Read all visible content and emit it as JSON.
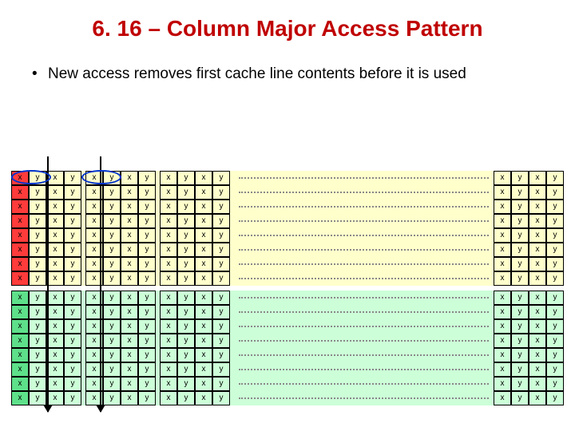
{
  "title": "6. 16 – Column Major Access Pattern",
  "bullet": "New access removes first cache line contents before it is used",
  "cell_x": "x",
  "cell_y": "y",
  "rows_per_block": 8,
  "groups_per_row": 3,
  "pairs_per_group": 2,
  "right_group_pairs": 2,
  "blocks": [
    {
      "bg": "top",
      "col0": "red"
    },
    {
      "bg": "bot",
      "col0": "green"
    }
  ],
  "chart_data": {
    "type": "table",
    "title": "Column Major Access Pattern cache layout",
    "description": "Two 8-row memory blocks (yellow then green). Each row is a sequence of interleaved x,y element pairs grouped into cache-line-sized chunks (4 elements = x y x y per group). Three full groups are shown on the left, an ellipsis, then one group on the right. First column of the top block is highlighted red (current cache line being evicted); first column of the bottom block is highlighted green (incoming cache line). Vertical arrows through column 0 and the start of the second cache-line group indicate column-major traversal order. Blue ellipses mark the first-row accesses in the first two cache lines.",
    "blocks": 2,
    "rows_per_block": 8,
    "visible_left_groups": 3,
    "visible_right_groups": 1,
    "elements_per_group": 4,
    "element_pattern": [
      "x",
      "y",
      "x",
      "y"
    ],
    "highlight": {
      "block0_col0": "red",
      "block1_col0": "green",
      "arrows_at_group_index": [
        0,
        1
      ],
      "ellipses_at": [
        "block0 row0 group0",
        "block0 row0 group1"
      ]
    }
  }
}
